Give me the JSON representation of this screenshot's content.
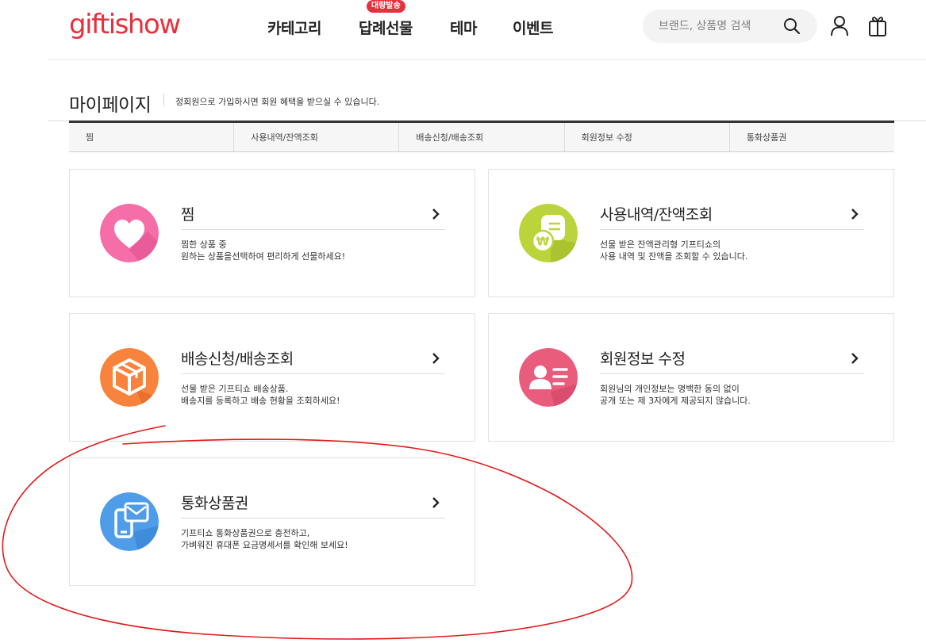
{
  "header": {
    "logo": "giftishow",
    "nav": [
      {
        "label": "카테고리"
      },
      {
        "label": "답례선물",
        "badge": "대량발송"
      },
      {
        "label": "테마"
      },
      {
        "label": "이벤트"
      }
    ],
    "search_placeholder": "브랜드, 상품명 검색",
    "brand_color": "#e8303c"
  },
  "page": {
    "title": "마이페이지",
    "description": "정회원으로 가입하시면 회원 혜택을 받으실 수 있습니다."
  },
  "tabs": [
    {
      "label": "찜"
    },
    {
      "label": "사용내역/잔액조회"
    },
    {
      "label": "배송신청/배송조회"
    },
    {
      "label": "회원정보 수정"
    },
    {
      "label": "통화상품권"
    }
  ],
  "cards": [
    {
      "title": "찜",
      "desc": [
        "찜한 상품 중",
        "원하는 상품을선택하여 편리하게 선물하세요!"
      ],
      "icon": "heart-icon",
      "color": "#f06ba5"
    },
    {
      "title": "사용내역/잔액조회",
      "desc": [
        "선물 받은 잔액관리형 기프티쇼의",
        "사용 내역 및 잔액을 조회할 수 있습니다."
      ],
      "icon": "won-coin-icon",
      "color": "#b8d13a"
    },
    {
      "title": "배송신청/배송조회",
      "desc": [
        "선물 받은 기프티쇼 배송상품.",
        "배송지를 등록하고 배송 현황을 조회하세요!"
      ],
      "icon": "box-icon",
      "color": "#f5813a"
    },
    {
      "title": "회원정보 수정",
      "desc": [
        "회원님의 개인정보는 명백한 동의 없이",
        "공개 또는 제 3자에게 제공되지 않습니다."
      ],
      "icon": "profile-icon",
      "color": "#e85a79"
    },
    {
      "title": "통화상품권",
      "desc": [
        "기프티쇼 통화상품권으로 충전하고,",
        "가벼워진 휴대폰 요금명세서를 확인해 보세요!"
      ],
      "icon": "phone-mail-icon",
      "color": "#4f9be8"
    }
  ]
}
